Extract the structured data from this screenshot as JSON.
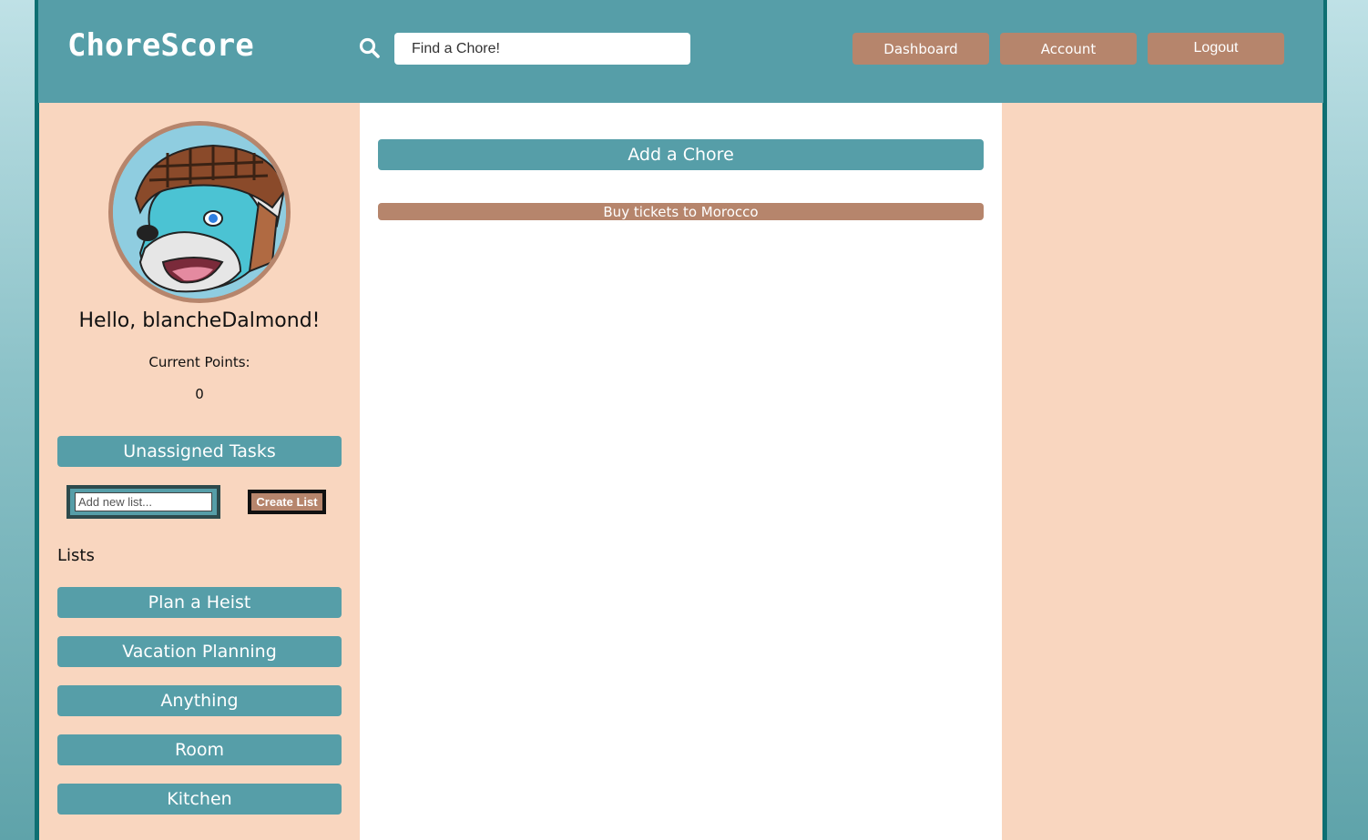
{
  "header": {
    "logo": "ChoreScore",
    "search_placeholder": "Find a Chore!",
    "nav": {
      "dashboard": "Dashboard",
      "account": "Account",
      "logout": "Logout"
    }
  },
  "profile": {
    "greeting": "Hello, blancheDalmond!",
    "points_label": "Current Points:",
    "points_value": "0"
  },
  "sidebar": {
    "unassigned_label": "Unassigned Tasks",
    "new_list_placeholder": "Add new list...",
    "create_list_label": "Create List",
    "lists_heading": "Lists",
    "lists": [
      "Plan a Heist",
      "Vacation Planning",
      "Anything",
      "Room",
      "Kitchen"
    ]
  },
  "main": {
    "add_chore_label": "Add a Chore",
    "chores": [
      "Buy tickets to Morocco"
    ]
  },
  "colors": {
    "teal": "#569ea8",
    "peach": "#f9d6bf",
    "brown": "#b6856c",
    "dark_teal": "#0e6f72"
  },
  "icons": {
    "search": "search-icon",
    "avatar": "wolf-knight-avatar-icon"
  }
}
